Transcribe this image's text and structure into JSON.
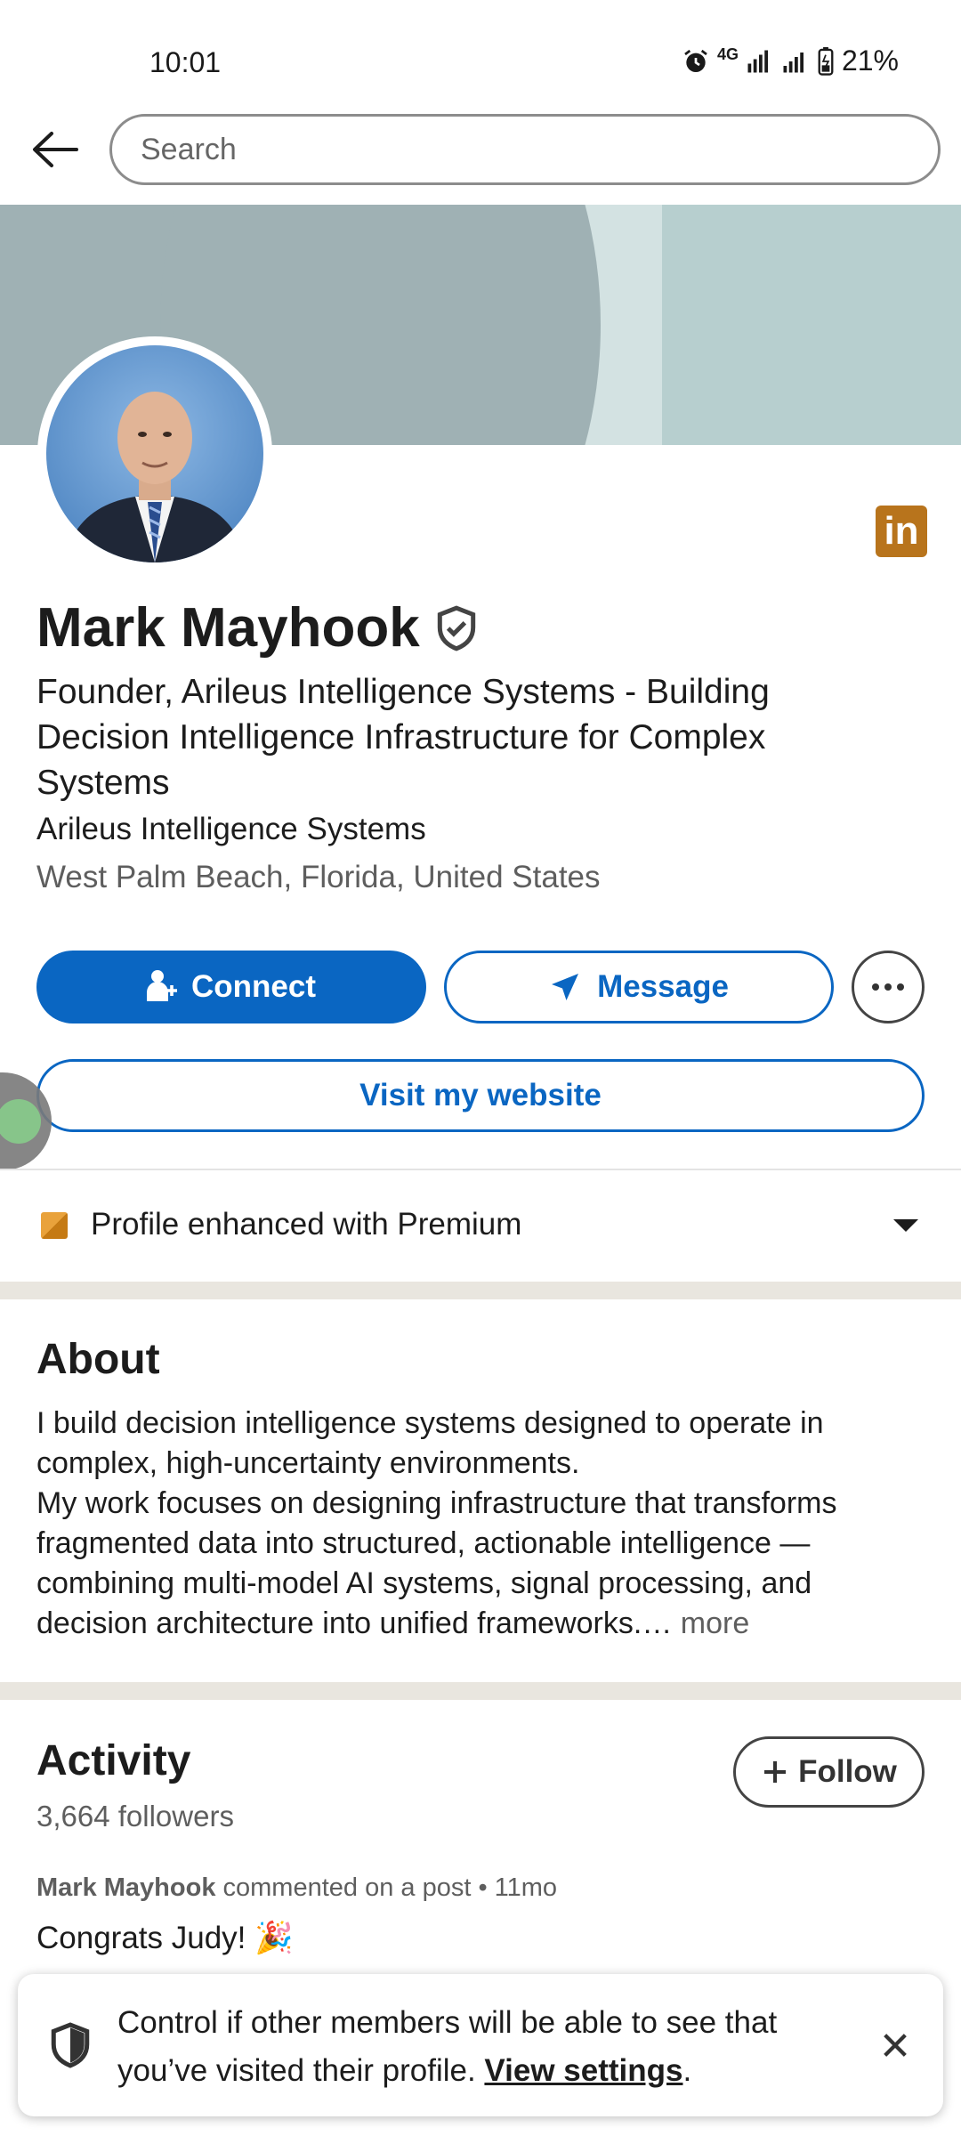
{
  "status_bar": {
    "time": "10:01",
    "battery": "21%",
    "network": "4G"
  },
  "header": {
    "search_placeholder": "Search"
  },
  "profile": {
    "name": "Mark Mayhook",
    "headline": "Founder, Arileus Intelligence Systems - Building Decision Intelligence Infrastructure for Complex Systems",
    "company": "Arileus Intelligence Systems",
    "location": "West Palm Beach, Florida, United States",
    "linkedin_badge": "in"
  },
  "actions": {
    "connect": "Connect",
    "message": "Message",
    "website": "Visit my website"
  },
  "premium": {
    "label": "Profile enhanced with Premium"
  },
  "about": {
    "title": "About",
    "text": "I build decision intelligence systems designed to operate in complex, high-uncertainty environments.\nMy work focuses on designing infrastructure that transforms fragmented data into structured, actionable intelligence — combining multi-model AI systems, signal processing, and decision architecture into unified frameworks.…",
    "more": " more"
  },
  "activity": {
    "title": "Activity",
    "followers": "3,664 followers",
    "follow_button": "Follow",
    "post_author": "Mark Mayhook",
    "post_action": " commented on a post • 11mo",
    "post_text": "Congrats Judy! 🎉"
  },
  "toast": {
    "text": "Control if other members will be able to see that you’ve visited their profile. ",
    "link": "View settings",
    "suffix": "."
  },
  "colors": {
    "primary": "#0a66c2",
    "premium": "#e9a23b",
    "banner": "#9fb1b4"
  }
}
